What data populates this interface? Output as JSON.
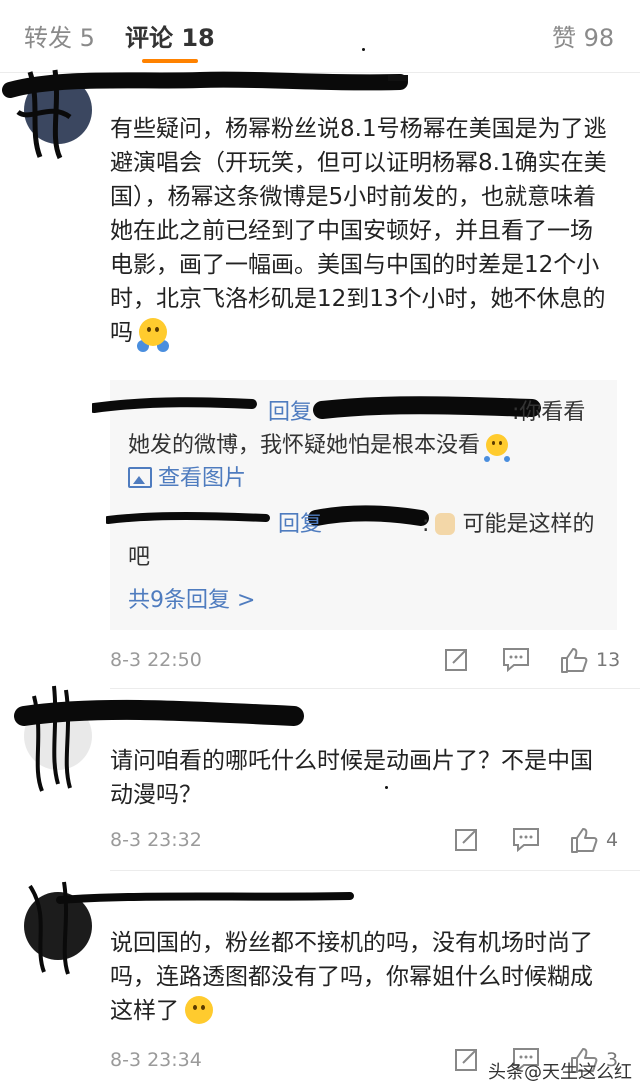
{
  "tabs": {
    "repost": "转发 5",
    "comments": "评论 18",
    "likes": "赞 98"
  },
  "accent_color": "#ff8200",
  "link_color": "#4f7cbf",
  "icons": [
    "share-icon",
    "comment-icon",
    "thumb-up-icon",
    "image-icon"
  ],
  "comments": [
    {
      "text": "有些疑问，杨幂粉丝说8.1号杨幂在美国是为了逃避演唱会（开玩笑，但可以证明杨幂8.1确实在美国），杨幂这条微博是5小时前发的，也就意味着她在此之前已经到了中国安顿好，并且看了一场电影，画了一幅画。美国与中国的时差是12个小时，北京飞洛杉矶是12到13个小时，她不休息的吗",
      "replies": [
        {
          "prefix": "回复",
          "suffix": ":你看看她发的微博，我怀疑她怕是根本没看",
          "view_image": "查看图片"
        },
        {
          "prefix": "回复",
          "suffix": ":",
          "text": "可能是这样的吧"
        }
      ],
      "more_replies": "共9条回复 >",
      "time": "8-3 22:50",
      "likes": "13"
    },
    {
      "text": "请问咱看的哪吒什么时候是动画片了？不是中国动漫吗？",
      "time": "8-3 23:32",
      "likes": "4"
    },
    {
      "text": "说回国的，粉丝都不接机的吗，没有机场时尚了吗，连路透图都没有了吗，你幂姐什么时候糊成这样了",
      "time": "8-3 23:34",
      "likes": "3"
    }
  ],
  "watermark": "头条@天生这么红"
}
